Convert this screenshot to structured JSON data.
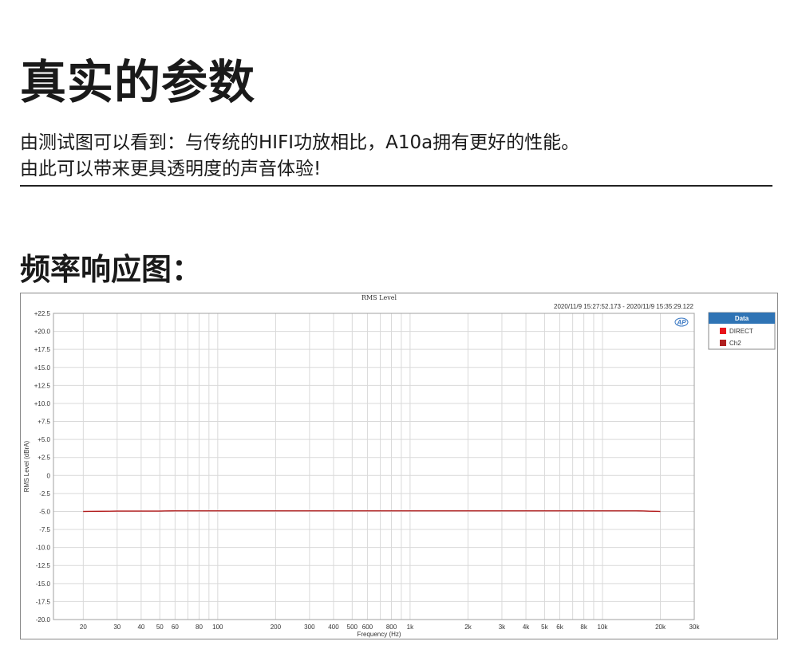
{
  "header": {
    "title": "真实的参数",
    "desc_line1": "由测试图可以看到：与传统的HIFI功放相比，A10a拥有更好的性能。",
    "desc_line2": "由此可以带来更具透明度的声音体验!"
  },
  "section": {
    "subtitle": "频率响应图："
  },
  "chart_data": {
    "type": "line",
    "title": "RMS Level",
    "subtitle": "2020/11/9 15:27:52.173 - 2020/11/9 15:35:29.122",
    "xlabel": "Frequency (Hz)",
    "ylabel": "RMS Level (dBrA)",
    "x_scale": "log",
    "xlim": [
      14,
      30000
    ],
    "ylim": [
      -20,
      22.5
    ],
    "grid": true,
    "legend_title": "Data",
    "legend_position": "right",
    "logo_text": "AP",
    "x_tick_labels": [
      {
        "v": 20,
        "t": "20"
      },
      {
        "v": 30,
        "t": "30"
      },
      {
        "v": 40,
        "t": "40"
      },
      {
        "v": 50,
        "t": "50"
      },
      {
        "v": 60,
        "t": "60"
      },
      {
        "v": 80,
        "t": "80"
      },
      {
        "v": 100,
        "t": "100"
      },
      {
        "v": 200,
        "t": "200"
      },
      {
        "v": 300,
        "t": "300"
      },
      {
        "v": 400,
        "t": "400"
      },
      {
        "v": 500,
        "t": "500"
      },
      {
        "v": 600,
        "t": "600"
      },
      {
        "v": 800,
        "t": "800"
      },
      {
        "v": 1000,
        "t": "1k"
      },
      {
        "v": 2000,
        "t": "2k"
      },
      {
        "v": 3000,
        "t": "3k"
      },
      {
        "v": 4000,
        "t": "4k"
      },
      {
        "v": 5000,
        "t": "5k"
      },
      {
        "v": 6000,
        "t": "6k"
      },
      {
        "v": 8000,
        "t": "8k"
      },
      {
        "v": 10000,
        "t": "10k"
      },
      {
        "v": 20000,
        "t": "20k"
      },
      {
        "v": 30000,
        "t": "30k"
      }
    ],
    "y_tick_labels": [
      {
        "v": 22.5,
        "t": "+22.5"
      },
      {
        "v": 20,
        "t": "+20.0"
      },
      {
        "v": 17.5,
        "t": "+17.5"
      },
      {
        "v": 15,
        "t": "+15.0"
      },
      {
        "v": 12.5,
        "t": "+12.5"
      },
      {
        "v": 10,
        "t": "+10.0"
      },
      {
        "v": 7.5,
        "t": "+7.5"
      },
      {
        "v": 5,
        "t": "+5.0"
      },
      {
        "v": 2.5,
        "t": "+2.5"
      },
      {
        "v": 0,
        "t": "0"
      },
      {
        "v": -2.5,
        "t": "-2.5"
      },
      {
        "v": -5,
        "t": "-5.0"
      },
      {
        "v": -7.5,
        "t": "-7.5"
      },
      {
        "v": -10,
        "t": "-10.0"
      },
      {
        "v": -12.5,
        "t": "-12.5"
      },
      {
        "v": -15,
        "t": "-15.0"
      },
      {
        "v": -17.5,
        "t": "-17.5"
      },
      {
        "v": -20,
        "t": "-20.0"
      }
    ],
    "series": [
      {
        "name": "DIRECT",
        "color": "#e8141b",
        "x": [
          20,
          30,
          50,
          60,
          100,
          1000,
          10000,
          15000,
          20000
        ],
        "y": [
          -5.0,
          -4.95,
          -4.95,
          -4.9,
          -4.9,
          -4.9,
          -4.9,
          -4.9,
          -5.0
        ]
      },
      {
        "name": "Ch2",
        "color": "#b02020",
        "x": [
          20,
          30,
          50,
          60,
          100,
          1000,
          10000,
          15000,
          20000
        ],
        "y": [
          -5.0,
          -4.95,
          -4.95,
          -4.9,
          -4.9,
          -4.9,
          -4.9,
          -4.9,
          -5.0
        ]
      }
    ]
  }
}
